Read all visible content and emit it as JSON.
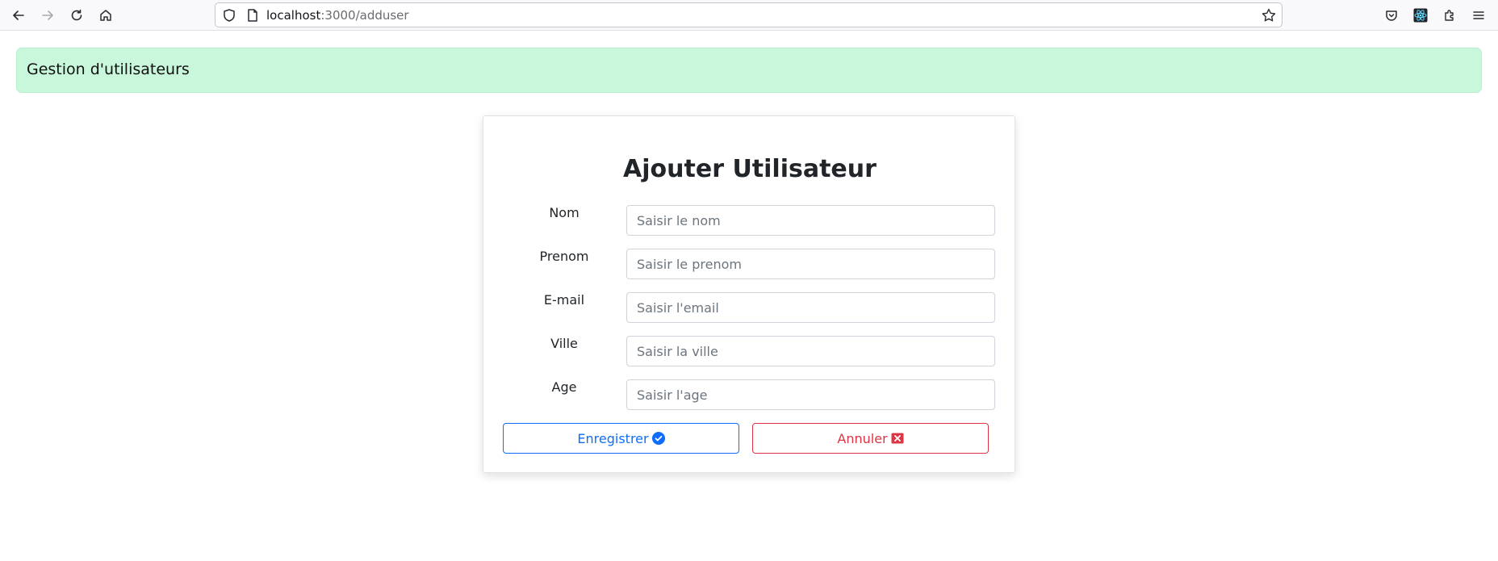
{
  "browser": {
    "url_host": "localhost",
    "url_path": ":3000/adduser"
  },
  "app": {
    "header_title": "Gestion d'utilisateurs"
  },
  "form": {
    "title": "Ajouter Utilisateur",
    "fields": [
      {
        "label": "Nom",
        "placeholder": "Saisir le nom",
        "value": ""
      },
      {
        "label": "Prenom",
        "placeholder": "Saisir le prenom",
        "value": ""
      },
      {
        "label": "E-mail",
        "placeholder": "Saisir l'email",
        "value": ""
      },
      {
        "label": "Ville",
        "placeholder": "Saisir la ville",
        "value": ""
      },
      {
        "label": "Age",
        "placeholder": "Saisir l'age",
        "value": ""
      }
    ],
    "save_label": "Enregistrer",
    "save_icon": "check-circle-icon",
    "cancel_label": "Annuler",
    "cancel_icon": "x-square-icon"
  },
  "colors": {
    "header_bg": "#c9f7dc",
    "primary": "#0d6efd",
    "danger": "#dc3545"
  }
}
